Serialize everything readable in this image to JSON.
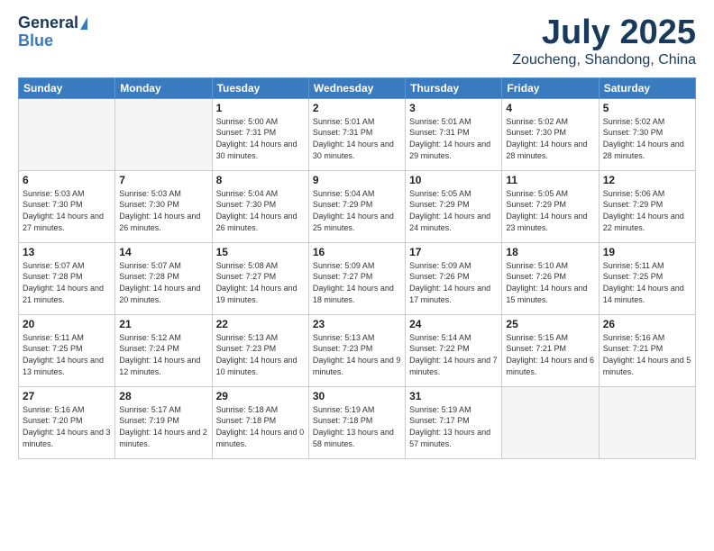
{
  "logo": {
    "line1": "General",
    "line2": "Blue"
  },
  "title": "July 2025",
  "subtitle": "Zoucheng, Shandong, China",
  "weekdays": [
    "Sunday",
    "Monday",
    "Tuesday",
    "Wednesday",
    "Thursday",
    "Friday",
    "Saturday"
  ],
  "weeks": [
    [
      {
        "day": "",
        "content": ""
      },
      {
        "day": "",
        "content": ""
      },
      {
        "day": "1",
        "content": "Sunrise: 5:00 AM\nSunset: 7:31 PM\nDaylight: 14 hours and 30 minutes."
      },
      {
        "day": "2",
        "content": "Sunrise: 5:01 AM\nSunset: 7:31 PM\nDaylight: 14 hours and 30 minutes."
      },
      {
        "day": "3",
        "content": "Sunrise: 5:01 AM\nSunset: 7:31 PM\nDaylight: 14 hours and 29 minutes."
      },
      {
        "day": "4",
        "content": "Sunrise: 5:02 AM\nSunset: 7:30 PM\nDaylight: 14 hours and 28 minutes."
      },
      {
        "day": "5",
        "content": "Sunrise: 5:02 AM\nSunset: 7:30 PM\nDaylight: 14 hours and 28 minutes."
      }
    ],
    [
      {
        "day": "6",
        "content": "Sunrise: 5:03 AM\nSunset: 7:30 PM\nDaylight: 14 hours and 27 minutes."
      },
      {
        "day": "7",
        "content": "Sunrise: 5:03 AM\nSunset: 7:30 PM\nDaylight: 14 hours and 26 minutes."
      },
      {
        "day": "8",
        "content": "Sunrise: 5:04 AM\nSunset: 7:30 PM\nDaylight: 14 hours and 26 minutes."
      },
      {
        "day": "9",
        "content": "Sunrise: 5:04 AM\nSunset: 7:29 PM\nDaylight: 14 hours and 25 minutes."
      },
      {
        "day": "10",
        "content": "Sunrise: 5:05 AM\nSunset: 7:29 PM\nDaylight: 14 hours and 24 minutes."
      },
      {
        "day": "11",
        "content": "Sunrise: 5:05 AM\nSunset: 7:29 PM\nDaylight: 14 hours and 23 minutes."
      },
      {
        "day": "12",
        "content": "Sunrise: 5:06 AM\nSunset: 7:29 PM\nDaylight: 14 hours and 22 minutes."
      }
    ],
    [
      {
        "day": "13",
        "content": "Sunrise: 5:07 AM\nSunset: 7:28 PM\nDaylight: 14 hours and 21 minutes."
      },
      {
        "day": "14",
        "content": "Sunrise: 5:07 AM\nSunset: 7:28 PM\nDaylight: 14 hours and 20 minutes."
      },
      {
        "day": "15",
        "content": "Sunrise: 5:08 AM\nSunset: 7:27 PM\nDaylight: 14 hours and 19 minutes."
      },
      {
        "day": "16",
        "content": "Sunrise: 5:09 AM\nSunset: 7:27 PM\nDaylight: 14 hours and 18 minutes."
      },
      {
        "day": "17",
        "content": "Sunrise: 5:09 AM\nSunset: 7:26 PM\nDaylight: 14 hours and 17 minutes."
      },
      {
        "day": "18",
        "content": "Sunrise: 5:10 AM\nSunset: 7:26 PM\nDaylight: 14 hours and 15 minutes."
      },
      {
        "day": "19",
        "content": "Sunrise: 5:11 AM\nSunset: 7:25 PM\nDaylight: 14 hours and 14 minutes."
      }
    ],
    [
      {
        "day": "20",
        "content": "Sunrise: 5:11 AM\nSunset: 7:25 PM\nDaylight: 14 hours and 13 minutes."
      },
      {
        "day": "21",
        "content": "Sunrise: 5:12 AM\nSunset: 7:24 PM\nDaylight: 14 hours and 12 minutes."
      },
      {
        "day": "22",
        "content": "Sunrise: 5:13 AM\nSunset: 7:23 PM\nDaylight: 14 hours and 10 minutes."
      },
      {
        "day": "23",
        "content": "Sunrise: 5:13 AM\nSunset: 7:23 PM\nDaylight: 14 hours and 9 minutes."
      },
      {
        "day": "24",
        "content": "Sunrise: 5:14 AM\nSunset: 7:22 PM\nDaylight: 14 hours and 7 minutes."
      },
      {
        "day": "25",
        "content": "Sunrise: 5:15 AM\nSunset: 7:21 PM\nDaylight: 14 hours and 6 minutes."
      },
      {
        "day": "26",
        "content": "Sunrise: 5:16 AM\nSunset: 7:21 PM\nDaylight: 14 hours and 5 minutes."
      }
    ],
    [
      {
        "day": "27",
        "content": "Sunrise: 5:16 AM\nSunset: 7:20 PM\nDaylight: 14 hours and 3 minutes."
      },
      {
        "day": "28",
        "content": "Sunrise: 5:17 AM\nSunset: 7:19 PM\nDaylight: 14 hours and 2 minutes."
      },
      {
        "day": "29",
        "content": "Sunrise: 5:18 AM\nSunset: 7:18 PM\nDaylight: 14 hours and 0 minutes."
      },
      {
        "day": "30",
        "content": "Sunrise: 5:19 AM\nSunset: 7:18 PM\nDaylight: 13 hours and 58 minutes."
      },
      {
        "day": "31",
        "content": "Sunrise: 5:19 AM\nSunset: 7:17 PM\nDaylight: 13 hours and 57 minutes."
      },
      {
        "day": "",
        "content": ""
      },
      {
        "day": "",
        "content": ""
      }
    ]
  ]
}
